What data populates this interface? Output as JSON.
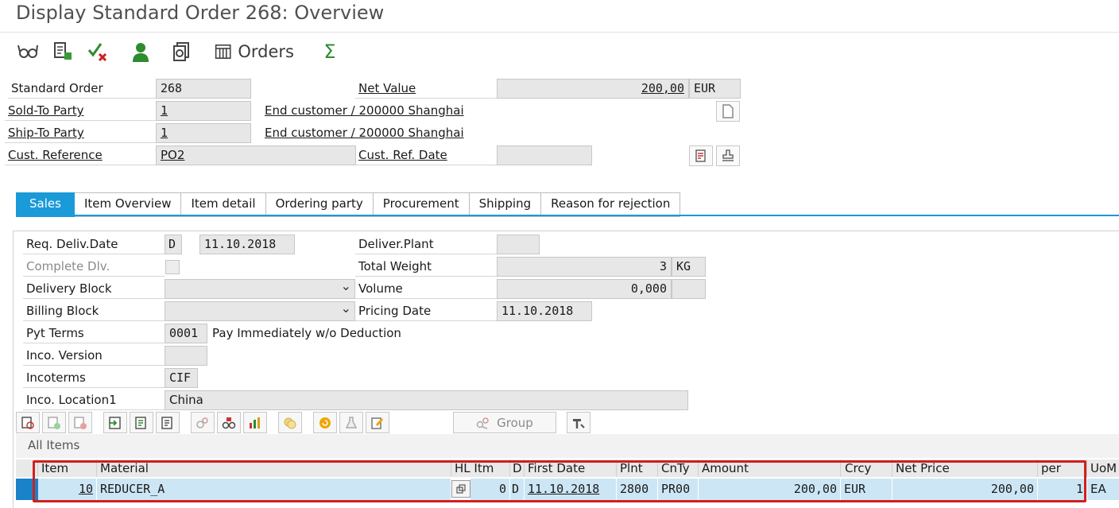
{
  "window": {
    "title": "Display Standard Order 268: Overview"
  },
  "toolbar": {
    "orders_label": "Orders",
    "sum_symbol": "Σ"
  },
  "header": {
    "standard_order_label": "Standard Order",
    "standard_order_value": "268",
    "net_value_label": "Net Value",
    "net_value": "200,00",
    "currency": "EUR",
    "sold_to_label": "Sold-To Party",
    "sold_to_value": "1",
    "sold_to_desc": "End customer / 200000 Shanghai",
    "ship_to_label": "Ship-To Party",
    "ship_to_value": "1",
    "ship_to_desc": "End customer / 200000 Shanghai",
    "cust_ref_label": "Cust. Reference",
    "cust_ref_value": "PO2",
    "cust_ref_date_label": "Cust. Ref. Date",
    "cust_ref_date_value": ""
  },
  "tabs": [
    "Sales",
    "Item Overview",
    "Item detail",
    "Ordering party",
    "Procurement",
    "Shipping",
    "Reason for rejection"
  ],
  "sales": {
    "req_deliv_date_label": "Req. Deliv.Date",
    "req_deliv_date_type": "D",
    "req_deliv_date_value": "11.10.2018",
    "deliver_plant_label": "Deliver.Plant",
    "complete_dlv_label": "Complete Dlv.",
    "total_weight_label": "Total Weight",
    "total_weight_value": "3",
    "total_weight_unit": "KG",
    "delivery_block_label": "Delivery Block",
    "volume_label": "Volume",
    "volume_value": "0,000",
    "billing_block_label": "Billing Block",
    "pricing_date_label": "Pricing Date",
    "pricing_date_value": "11.10.2018",
    "pyt_terms_label": "Pyt Terms",
    "pyt_terms_code": "0001",
    "pyt_terms_desc": "Pay Immediately w/o Deduction",
    "inco_version_label": "Inco. Version",
    "incoterms_label": "Incoterms",
    "incoterms_value": "CIF",
    "inco_location_label": "Inco. Location1",
    "inco_location_value": "China"
  },
  "grid_toolbar": {
    "group_label": "Group"
  },
  "items": {
    "section_title": "All Items",
    "columns": [
      "Item",
      "Material",
      "HL Itm",
      "D",
      "First Date",
      "Plnt",
      "CnTy",
      "Amount",
      "Crcy",
      "Net Price",
      "per",
      "UoM"
    ],
    "rows": [
      {
        "item": "10",
        "material": "REDUCER_A",
        "hl_itm": "0",
        "d": "D",
        "first_date": "11.10.2018",
        "plnt": "2800",
        "cnty": "PR00",
        "amount": "200,00",
        "crcy": "EUR",
        "net_price": "200,00",
        "per": "1",
        "uom": "EA"
      }
    ]
  }
}
